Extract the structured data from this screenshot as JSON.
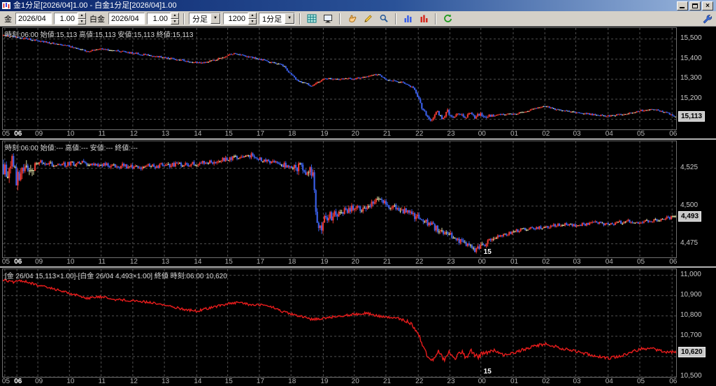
{
  "window": {
    "title": "金1分足[2026/04]1.00 - 白金1分足[2026/04]1.00"
  },
  "toolbar": {
    "gold_label": "金",
    "gold_contract": "2026/04",
    "gold_ratio": "1.00",
    "platinum_label": "白金",
    "platinum_contract": "2026/04",
    "platinum_ratio": "1.00",
    "period_type": "分足",
    "bar_count": "1200",
    "period": "1分足",
    "icons": [
      "grid-icon",
      "screen-icon",
      "hand-icon",
      "pencil-icon",
      "zoom-icon",
      "chart-bars-blue-icon",
      "chart-bars-red-icon",
      "refresh-icon",
      "wrench-icon"
    ]
  },
  "time_axis": {
    "ticks": [
      {
        "label": "05",
        "t": 0.003
      },
      {
        "label": "06",
        "t": 0.021,
        "strong": true
      },
      {
        "label": "09",
        "t": 0.052
      },
      {
        "label": "10",
        "t": 0.099
      },
      {
        "label": "11",
        "t": 0.146
      },
      {
        "label": "12",
        "t": 0.193
      },
      {
        "label": "13",
        "t": 0.24
      },
      {
        "label": "14",
        "t": 0.288
      },
      {
        "label": "15",
        "t": 0.334
      },
      {
        "label": "17",
        "t": 0.381
      },
      {
        "label": "18",
        "t": 0.428
      },
      {
        "label": "19",
        "t": 0.476
      },
      {
        "label": "20",
        "t": 0.522
      },
      {
        "label": "21",
        "t": 0.569
      },
      {
        "label": "22",
        "t": 0.617
      },
      {
        "label": "23",
        "t": 0.664
      },
      {
        "label": "00",
        "t": 0.71
      },
      {
        "label": "01",
        "t": 0.758
      },
      {
        "label": "02",
        "t": 0.805
      },
      {
        "label": "03",
        "t": 0.851
      },
      {
        "label": "04",
        "t": 0.899
      },
      {
        "label": "05",
        "t": 0.946
      },
      {
        "label": "06",
        "t": 0.994
      }
    ]
  },
  "chart_data": [
    {
      "type": "candlestick",
      "info": "時刻:06:00 始値:15,113 高値:15,113 安値:15,113 終値:15,113",
      "y_domain": [
        15050,
        15555
      ],
      "grid_step": 100,
      "axis_labels": [
        {
          "v": 15500,
          "label": "15,500"
        },
        {
          "v": 15400,
          "label": "15,400"
        },
        {
          "v": 15300,
          "label": "15,300"
        },
        {
          "v": 15200,
          "label": "15,200"
        }
      ],
      "price_box": {
        "v": 15113,
        "label": "15,113"
      },
      "bars": 470,
      "up_color": "#e8382e",
      "down_color": "#3a5fe8",
      "doji_color": "#d8d8b0",
      "noise_zones": [
        [
          0,
          0.61,
          4
        ],
        [
          0.61,
          0.73,
          9
        ],
        [
          0.73,
          1,
          4
        ]
      ],
      "keypoints": [
        [
          0.003,
          15518
        ],
        [
          0.021,
          15508
        ],
        [
          0.052,
          15492
        ],
        [
          0.099,
          15462
        ],
        [
          0.125,
          15438
        ],
        [
          0.146,
          15452
        ],
        [
          0.193,
          15430
        ],
        [
          0.24,
          15408
        ],
        [
          0.28,
          15386
        ],
        [
          0.296,
          15381
        ],
        [
          0.317,
          15398
        ],
        [
          0.34,
          15428
        ],
        [
          0.381,
          15400
        ],
        [
          0.416,
          15368
        ],
        [
          0.436,
          15295
        ],
        [
          0.458,
          15268
        ],
        [
          0.476,
          15300
        ],
        [
          0.522,
          15303
        ],
        [
          0.557,
          15325
        ],
        [
          0.569,
          15300
        ],
        [
          0.592,
          15285
        ],
        [
          0.612,
          15255
        ],
        [
          0.621,
          15170
        ],
        [
          0.629,
          15120
        ],
        [
          0.637,
          15098
        ],
        [
          0.645,
          15145
        ],
        [
          0.653,
          15100
        ],
        [
          0.661,
          15140
        ],
        [
          0.669,
          15104
        ],
        [
          0.677,
          15138
        ],
        [
          0.685,
          15108
        ],
        [
          0.693,
          15132
        ],
        [
          0.701,
          15110
        ],
        [
          0.71,
          15126
        ],
        [
          0.72,
          15112
        ],
        [
          0.734,
          15124
        ],
        [
          0.758,
          15126
        ],
        [
          0.79,
          15152
        ],
        [
          0.805,
          15168
        ],
        [
          0.822,
          15150
        ],
        [
          0.851,
          15136
        ],
        [
          0.88,
          15122
        ],
        [
          0.899,
          15117
        ],
        [
          0.93,
          15131
        ],
        [
          0.946,
          15142
        ],
        [
          0.966,
          15150
        ],
        [
          0.985,
          15136
        ],
        [
          1,
          15113
        ]
      ],
      "date_marker": null
    },
    {
      "type": "candlestick",
      "info": "時刻:06:00 始値:--- 高値:--- 安値:--- 終値:---",
      "y_domain": [
        4466,
        4543
      ],
      "grid_step": 25,
      "axis_labels": [
        {
          "v": 4525,
          "label": "4,525"
        },
        {
          "v": 4500,
          "label": "4,500"
        },
        {
          "v": 4475,
          "label": "4,475"
        }
      ],
      "price_box": {
        "v": 4493,
        "label": "4,493"
      },
      "bars": 470,
      "up_color": "#e8382e",
      "down_color": "#3a5fe8",
      "doji_color": "#d8d8a0",
      "noise_zones": [
        [
          0,
          0.045,
          5
        ],
        [
          0.045,
          0.43,
          1.6
        ],
        [
          0.43,
          0.5,
          3.2
        ],
        [
          0.5,
          0.62,
          2.2
        ],
        [
          0.62,
          0.73,
          2.2
        ],
        [
          0.73,
          1,
          1.1
        ]
      ],
      "keypoints": [
        [
          0.003,
          4526
        ],
        [
          0.008,
          4519
        ],
        [
          0.014,
          4531
        ],
        [
          0.02,
          4516
        ],
        [
          0.028,
          4528
        ],
        [
          0.04,
          4524
        ],
        [
          0.052,
          4529
        ],
        [
          0.08,
          4527
        ],
        [
          0.12,
          4529
        ],
        [
          0.16,
          4527
        ],
        [
          0.2,
          4526
        ],
        [
          0.24,
          4527
        ],
        [
          0.288,
          4528
        ],
        [
          0.32,
          4530
        ],
        [
          0.35,
          4533
        ],
        [
          0.37,
          4534
        ],
        [
          0.381,
          4531
        ],
        [
          0.41,
          4528
        ],
        [
          0.428,
          4526
        ],
        [
          0.44,
          4526
        ],
        [
          0.46,
          4522
        ],
        [
          0.468,
          4482
        ],
        [
          0.478,
          4491
        ],
        [
          0.5,
          4496
        ],
        [
          0.522,
          4499
        ],
        [
          0.54,
          4497
        ],
        [
          0.557,
          4507
        ],
        [
          0.569,
          4501
        ],
        [
          0.59,
          4498
        ],
        [
          0.607,
          4495
        ],
        [
          0.617,
          4492
        ],
        [
          0.63,
          4489
        ],
        [
          0.65,
          4484
        ],
        [
          0.664,
          4481
        ],
        [
          0.68,
          4476
        ],
        [
          0.7,
          4471
        ],
        [
          0.715,
          4474
        ],
        [
          0.73,
          4479
        ],
        [
          0.758,
          4483
        ],
        [
          0.78,
          4485
        ],
        [
          0.805,
          4486
        ],
        [
          0.83,
          4488
        ],
        [
          0.851,
          4487
        ],
        [
          0.88,
          4489
        ],
        [
          0.899,
          4488
        ],
        [
          0.93,
          4490
        ],
        [
          0.946,
          4489
        ],
        [
          0.975,
          4491
        ],
        [
          1,
          4493
        ]
      ],
      "date_marker": {
        "label": "15",
        "t": 0.712
      }
    },
    {
      "type": "line",
      "info": "[金 26/04 15,113×1.00]-[白金 26/04 4,493×1.00] 終値 時刻:06:00 10,620",
      "y_domain": [
        10500,
        11030
      ],
      "grid_step": 100,
      "axis_labels": [
        {
          "v": 11000,
          "label": "11,000"
        },
        {
          "v": 10900,
          "label": "10,900"
        },
        {
          "v": 10800,
          "label": "10,800"
        },
        {
          "v": 10700,
          "label": "10,700"
        },
        {
          "v": 10500,
          "label": "10,500"
        }
      ],
      "price_box": {
        "v": 10620,
        "label": "10,620"
      },
      "color": "#e81c1c",
      "noise_zones": [
        [
          0,
          0.6,
          6
        ],
        [
          0.6,
          0.625,
          10
        ],
        [
          0.625,
          0.72,
          14
        ],
        [
          0.72,
          1,
          7
        ]
      ],
      "keypoints": [
        [
          0,
          10978
        ],
        [
          0.015,
          10966
        ],
        [
          0.03,
          10974
        ],
        [
          0.052,
          10950
        ],
        [
          0.075,
          10934
        ],
        [
          0.099,
          10912
        ],
        [
          0.125,
          10888
        ],
        [
          0.146,
          10894
        ],
        [
          0.17,
          10880
        ],
        [
          0.193,
          10876
        ],
        [
          0.22,
          10866
        ],
        [
          0.24,
          10854
        ],
        [
          0.27,
          10832
        ],
        [
          0.288,
          10824
        ],
        [
          0.31,
          10842
        ],
        [
          0.334,
          10860
        ],
        [
          0.355,
          10866
        ],
        [
          0.37,
          10852
        ],
        [
          0.381,
          10856
        ],
        [
          0.4,
          10844
        ],
        [
          0.416,
          10820
        ],
        [
          0.436,
          10802
        ],
        [
          0.458,
          10784
        ],
        [
          0.476,
          10788
        ],
        [
          0.5,
          10800
        ],
        [
          0.522,
          10808
        ],
        [
          0.54,
          10814
        ],
        [
          0.557,
          10800
        ],
        [
          0.569,
          10794
        ],
        [
          0.59,
          10786
        ],
        [
          0.607,
          10762
        ],
        [
          0.617,
          10715
        ],
        [
          0.625,
          10640
        ],
        [
          0.632,
          10598
        ],
        [
          0.64,
          10578
        ],
        [
          0.648,
          10630
        ],
        [
          0.656,
          10580
        ],
        [
          0.664,
          10625
        ],
        [
          0.672,
          10585
        ],
        [
          0.68,
          10628
        ],
        [
          0.688,
          10592
        ],
        [
          0.696,
          10626
        ],
        [
          0.705,
          10600
        ],
        [
          0.715,
          10618
        ],
        [
          0.73,
          10630
        ],
        [
          0.745,
          10608
        ],
        [
          0.758,
          10618
        ],
        [
          0.775,
          10636
        ],
        [
          0.79,
          10652
        ],
        [
          0.805,
          10662
        ],
        [
          0.82,
          10650
        ],
        [
          0.835,
          10636
        ],
        [
          0.851,
          10626
        ],
        [
          0.875,
          10608
        ],
        [
          0.899,
          10592
        ],
        [
          0.92,
          10605
        ],
        [
          0.935,
          10625
        ],
        [
          0.95,
          10640
        ],
        [
          0.965,
          10638
        ],
        [
          0.98,
          10625
        ],
        [
          1,
          10620
        ]
      ],
      "date_marker": {
        "label": "15",
        "t": 0.712
      }
    }
  ]
}
